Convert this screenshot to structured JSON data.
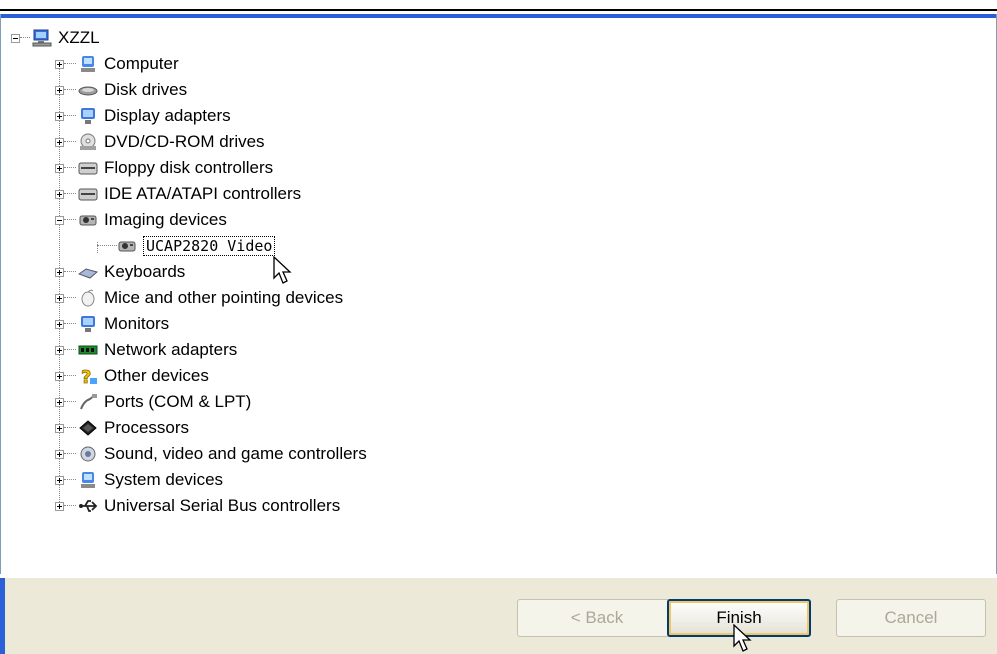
{
  "tree": {
    "root": {
      "label": "XZZL",
      "icon": "computer-icon"
    },
    "categories": [
      {
        "label": "Computer",
        "icon": "computer-icon",
        "expanded": false
      },
      {
        "label": "Disk drives",
        "icon": "disk-drive-icon",
        "expanded": false
      },
      {
        "label": "Display adapters",
        "icon": "display-adapter-icon",
        "expanded": false
      },
      {
        "label": "DVD/CD-ROM drives",
        "icon": "dvd-drive-icon",
        "expanded": false
      },
      {
        "label": "Floppy disk controllers",
        "icon": "floppy-controller-icon",
        "expanded": false
      },
      {
        "label": "IDE ATA/ATAPI controllers",
        "icon": "ide-controller-icon",
        "expanded": false
      },
      {
        "label": "Imaging devices",
        "icon": "camera-icon",
        "expanded": true,
        "children": [
          "UCAP2820 Video"
        ]
      },
      {
        "label": "Keyboards",
        "icon": "keyboard-icon",
        "expanded": false
      },
      {
        "label": "Mice and other pointing devices",
        "icon": "mouse-icon",
        "expanded": false
      },
      {
        "label": "Monitors",
        "icon": "monitor-icon",
        "expanded": false
      },
      {
        "label": "Network adapters",
        "icon": "network-adapter-icon",
        "expanded": false
      },
      {
        "label": "Other devices",
        "icon": "question-icon",
        "expanded": false
      },
      {
        "label": "Ports (COM & LPT)",
        "icon": "port-icon",
        "expanded": false
      },
      {
        "label": "Processors",
        "icon": "processor-icon",
        "expanded": false
      },
      {
        "label": "Sound, video and game controllers",
        "icon": "sound-icon",
        "expanded": false
      },
      {
        "label": "System devices",
        "icon": "system-device-icon",
        "expanded": false
      },
      {
        "label": "Universal Serial Bus controllers",
        "icon": "usb-icon",
        "expanded": false
      }
    ]
  },
  "buttons": {
    "back": "< Back",
    "finish": "Finish",
    "cancel": "Cancel"
  },
  "colors": {
    "accent": "#2b5fd9",
    "footer_bg": "#ece9d8",
    "disabled_text": "#aca899"
  }
}
